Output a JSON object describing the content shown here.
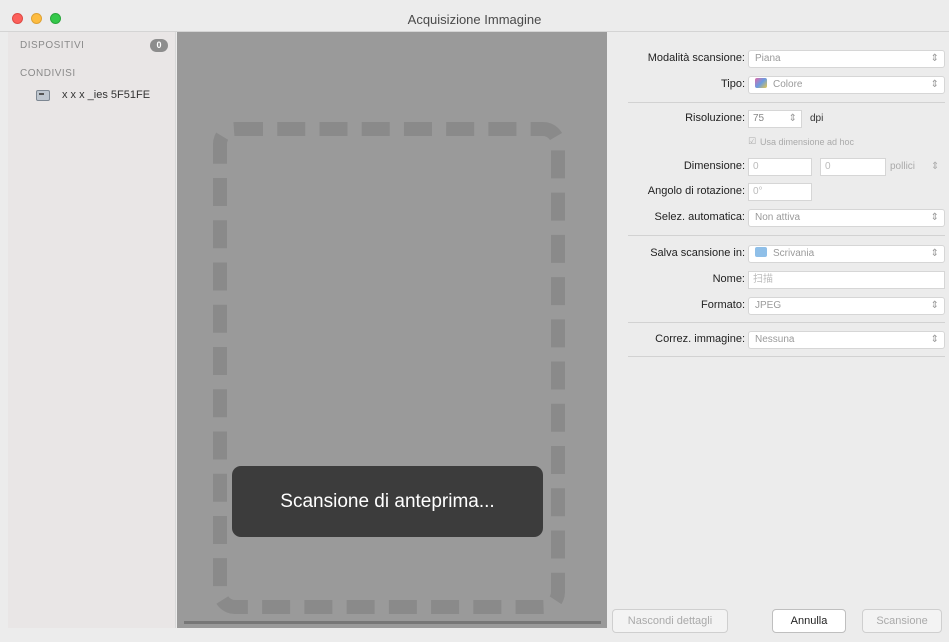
{
  "window": {
    "title": "Acquisizione Immagine"
  },
  "sidebar": {
    "devices_header": "DISPOSITIVI",
    "devices_count": "0",
    "shared_header": "CONDIVISI",
    "shared_items": [
      {
        "label": "x x x _ies 5F51FE"
      }
    ]
  },
  "preview": {
    "status": "Scansione di anteprima..."
  },
  "settings": {
    "scan_mode": {
      "label": "Modalità scansione:",
      "value": "Piana"
    },
    "type": {
      "label": "Tipo:",
      "value": "Colore"
    },
    "resolution": {
      "label": "Risoluzione:",
      "value": "75",
      "unit": "dpi"
    },
    "custom_size": {
      "label": "Usa dimensione ad hoc",
      "checked": true
    },
    "size": {
      "label": "Dimensione:",
      "width": "0",
      "height": "0",
      "unit": "pollici"
    },
    "rotation": {
      "label": "Angolo di rotazione:",
      "value": "0°"
    },
    "auto_select": {
      "label": "Selez. automatica:",
      "value": "Non attiva"
    },
    "save_to": {
      "label": "Salva scansione in:",
      "value": "Scrivania"
    },
    "name": {
      "label": "Nome:",
      "value": "扫描"
    },
    "format": {
      "label": "Formato:",
      "value": "JPEG"
    },
    "correction": {
      "label": "Correz. immagine:",
      "value": "Nessuna"
    }
  },
  "buttons": {
    "hide_details": "Nascondi dettagli",
    "cancel": "Annulla",
    "scan": "Scansione"
  }
}
